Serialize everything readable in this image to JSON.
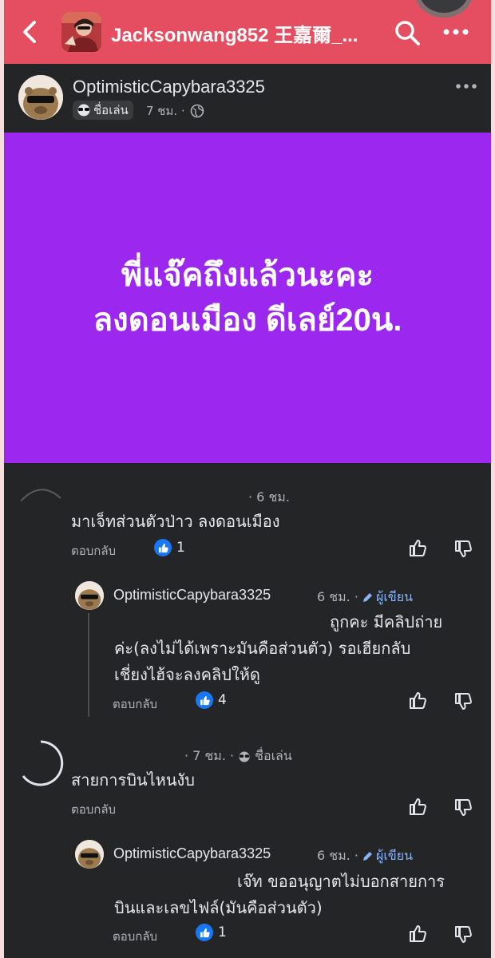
{
  "header": {
    "title": "Jacksonwang852 王嘉爾_..."
  },
  "post": {
    "author": "OptimisticCapybara3325",
    "badge": "ชื่อเล่น",
    "time": "7 ชม. ·",
    "lines": [
      "พี่แจ๊คถึงแล้วนะคะ",
      "ลงดอนเมือง ดีเลย์20น."
    ]
  },
  "comments": [
    {
      "meta": "· 6 ชม.",
      "text": "มาเจ็ทส่วนตัวป่าว ลงดอนเมือง",
      "reply_label": "ตอบกลับ",
      "likes": "1",
      "reply": {
        "name": "OptimisticCapybara3325",
        "time": "6 ชม. ·",
        "tag": "ผู้เขียน",
        "lines": [
          "ถูกคะ มีคลิปถ่าย",
          "ค่ะ(ลงไม่ได้เพราะมันคือส่วนตัว) รอเฮียกลับ",
          "เชี่ยงไฮ้จะลงคลิปให้ดู"
        ],
        "reply_label": "ตอบกลับ",
        "likes": "4"
      }
    },
    {
      "meta": "· 7 ชม. ·",
      "badge": "ชื่อเล่น",
      "text": "สายการบินไหนงับ",
      "reply_label": "ตอบกลับ",
      "reply": {
        "name": "OptimisticCapybara3325",
        "time": "6 ชม. ·",
        "tag": "ผู้เขียน",
        "lines": [
          "เจ๊ท ขออนุญาตไม่บอกสายการ",
          "บินและเลขไฟล์(มันคือส่วนตัว)"
        ],
        "reply_label": "ตอบกลับ",
        "likes": "1"
      }
    }
  ],
  "colors": {
    "header": "#e54e60",
    "post_bg": "#9c27ef",
    "panel": "#242527",
    "like": "#1877f2",
    "author_tag": "#8ab4f8"
  },
  "icons": [
    "back-chevron-icon",
    "search-icon",
    "more-icon",
    "globe-icon",
    "sunglasses-icon",
    "thumbs-up-icon",
    "thumbs-down-icon",
    "pencil-icon"
  ]
}
